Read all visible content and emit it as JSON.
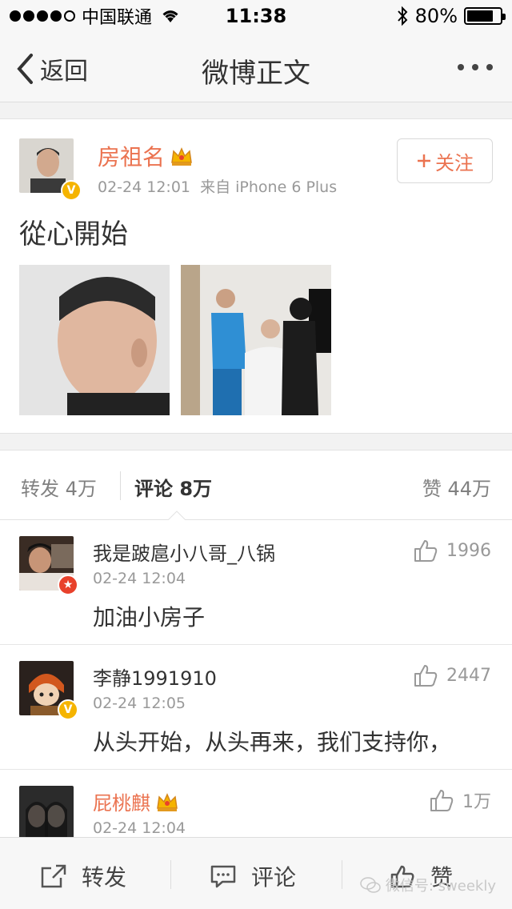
{
  "status_bar": {
    "carrier": "中国联通",
    "time": "11:38",
    "battery": "80%",
    "battery_level": 0.8,
    "signal_bars": 4
  },
  "nav": {
    "back_label": "返回",
    "title": "微博正文",
    "more_icon": "more-dots-icon"
  },
  "post": {
    "author": "房祖名",
    "timestamp": "02-24 12:01",
    "source": "来自 iPhone 6 Plus",
    "follow_label": "关注",
    "text": "從心開始",
    "images": [
      "photo-portrait",
      "photo-haircut"
    ]
  },
  "tabs": {
    "repost": "转发 4万",
    "comment": "评论 8万",
    "like": "赞 44万"
  },
  "comments": [
    {
      "name": "我是跛扈小八哥_八锅",
      "time": "02-24 12:04",
      "text": "加油小房子",
      "likes": "1996"
    },
    {
      "name": "李静1991910",
      "time": "02-24 12:05",
      "text": "从头开始，从头再来，我们支持你，",
      "likes": "2447"
    },
    {
      "name": "屁桃麒",
      "time": "02-24 12:04",
      "text": "",
      "likes": "1万"
    }
  ],
  "toolbar": {
    "repost": "转发",
    "comment": "评论",
    "like": "赞"
  },
  "watermark": "微信号: sweekly",
  "colors": {
    "accent": "#eb7350",
    "vip_gold": "#f5b400",
    "badge_red": "#e8412b",
    "text": "#333333",
    "muted": "#999999"
  }
}
